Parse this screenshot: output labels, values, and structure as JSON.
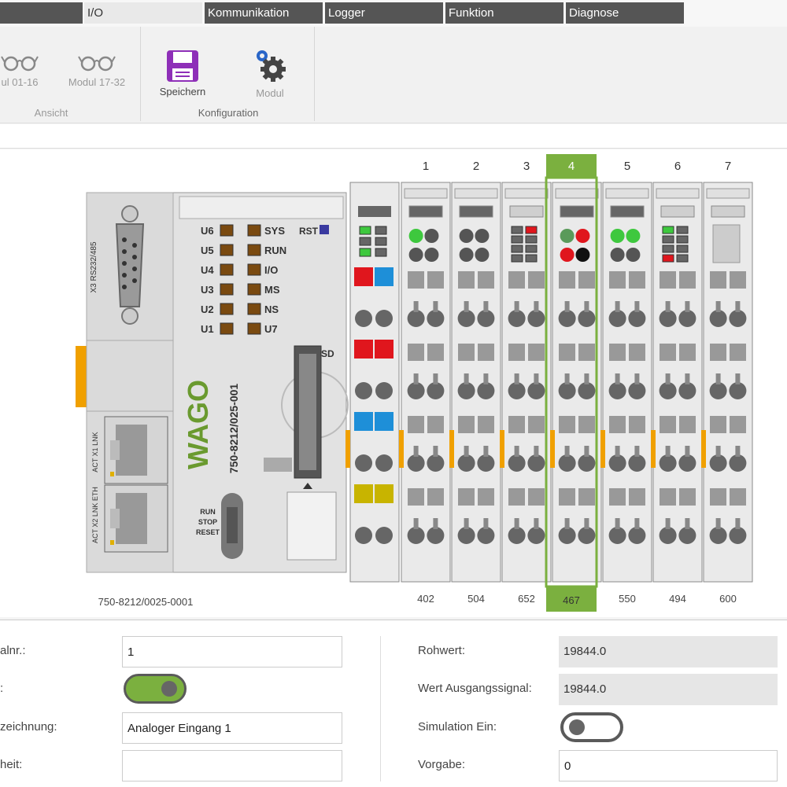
{
  "tabs": [
    {
      "label": "I/O",
      "active": true
    },
    {
      "label": "Kommunikation"
    },
    {
      "label": "Logger"
    },
    {
      "label": "Funktion"
    },
    {
      "label": "Diagnose"
    }
  ],
  "ribbon": {
    "modul_01_label": "ul 01-16",
    "modul_17_label": "Modul 17-32",
    "ansicht_group": "Ansicht",
    "speichern_label": "Speichern",
    "modul_label": "Modul",
    "konfiguration_group": "Konfiguration"
  },
  "device": {
    "controller_id": "750-8212/0025-0001",
    "model_text": "750-8212/025-001",
    "brand": "WAGO",
    "port_label": "X3 RS232/485",
    "sd_label": "SD",
    "rst_label": "RST",
    "switch_labels": [
      "RUN",
      "STOP",
      "RESET"
    ],
    "eth1_label": "ACT X1 LNK",
    "eth2_label": "ACT X2 LNK ETH",
    "leds_left": [
      "U6",
      "U5",
      "U4",
      "U3",
      "U2",
      "U1"
    ],
    "leds_right": [
      "SYS",
      "RUN",
      "I/O",
      "MS",
      "NS",
      "U7"
    ],
    "modules": [
      {
        "num": "1",
        "code": "402"
      },
      {
        "num": "2",
        "code": "504"
      },
      {
        "num": "3",
        "code": "652"
      },
      {
        "num": "4",
        "code": "467",
        "selected": true
      },
      {
        "num": "5",
        "code": "550"
      },
      {
        "num": "6",
        "code": "494"
      },
      {
        "num": "7",
        "code": "600"
      }
    ]
  },
  "form": {
    "kanal_label": "alnr.:",
    "kanal_value": "1",
    "toggle_label": ":",
    "bezeichnung_label": "zeichnung:",
    "bezeichnung_value": "Analoger Eingang 1",
    "einheit_label": "heit:",
    "einheit_value": "",
    "rohwert_label": "Rohwert:",
    "rohwert_value": "19844.0",
    "ausgang_label": "Wert Ausgangssignal:",
    "ausgang_value": "19844.0",
    "simulation_label": "Simulation Ein:",
    "vorgabe_label": "Vorgabe:",
    "vorgabe_value": "0"
  },
  "colors": {
    "accent_green": "#7bb03f",
    "led_green": "#3ec83e",
    "led_red": "#e0161d",
    "tab_dark": "#555555"
  }
}
